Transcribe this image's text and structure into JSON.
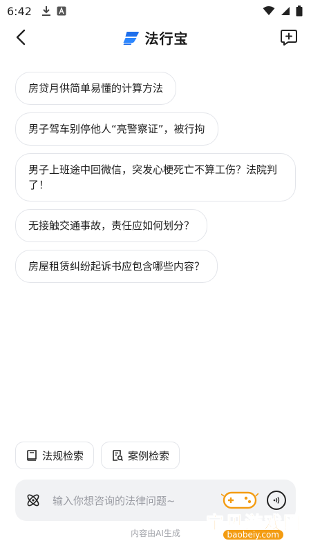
{
  "status_bar": {
    "time": "6:42"
  },
  "header": {
    "brand_name": "法行宝",
    "brand_color": "#1f6feb"
  },
  "suggestions": [
    "房贷月供简单易懂的计算方法",
    "男子驾车别停他人“亮警察证”，被行拘",
    "男子上班途中回微信，突发心梗死亡不算工伤？法院判了！",
    "无接触交通事故，责任应如何划分？",
    "房屋租赁纠纷起诉书应包含哪些内容？"
  ],
  "tools": {
    "law_search_label": "法规检索",
    "case_search_label": "案例检索"
  },
  "input": {
    "placeholder": "输入你想咨询的法律问题~"
  },
  "disclaimer": "内容由AI生成",
  "watermark": {
    "title": "宝贝游戏网",
    "url": "baobeiy.com",
    "color": "#f39c12"
  }
}
